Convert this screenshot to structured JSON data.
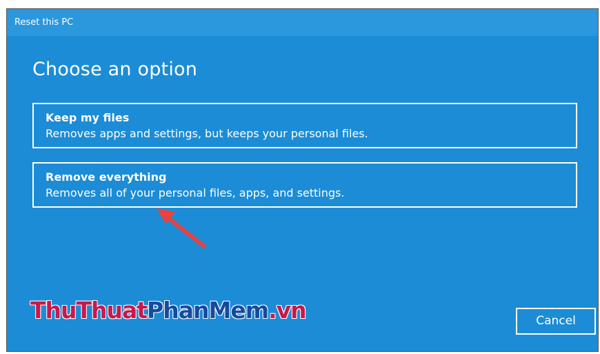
{
  "window": {
    "title": "Reset this PC"
  },
  "main": {
    "heading": "Choose an option",
    "options": [
      {
        "title": "Keep my files",
        "description": "Removes apps and settings, but keeps your personal files."
      },
      {
        "title": "Remove everything",
        "description": "Removes all of your personal files, apps, and settings."
      }
    ],
    "cancel_label": "Cancel"
  },
  "watermark": {
    "part1": "ThuThuat",
    "part2": "PhanMem",
    "part3": ".vn"
  },
  "colors": {
    "background": "#1c8cd6",
    "titlebar": "#2b97dc",
    "text": "#ffffff",
    "arrow": "#e8433f"
  }
}
